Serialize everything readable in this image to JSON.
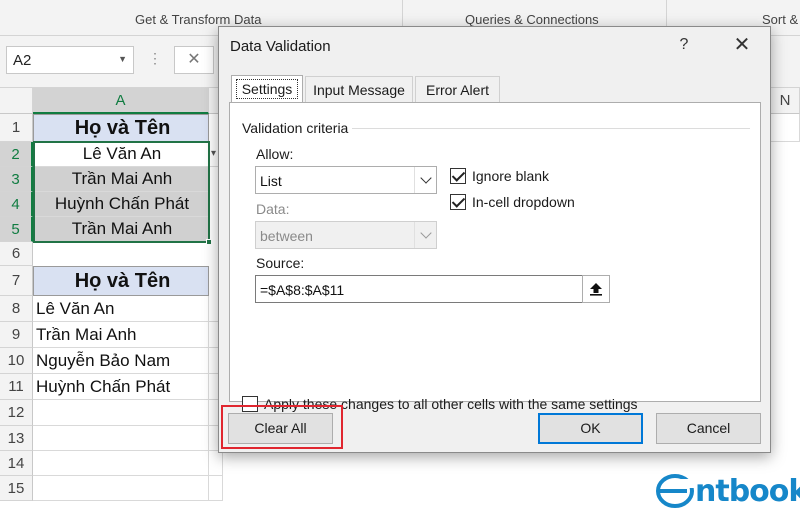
{
  "ribbon": {
    "groups": [
      "Get & Transform Data",
      "Queries & Connections",
      "Sort &"
    ]
  },
  "formula_bar": {
    "name_box": "A2",
    "cancel_symbol": "✕"
  },
  "sheet": {
    "columns": [
      "A",
      "N"
    ],
    "rows": [
      "1",
      "2",
      "3",
      "4",
      "5",
      "6",
      "7",
      "8",
      "9",
      "10",
      "11",
      "12",
      "13",
      "14",
      "15"
    ],
    "header1": "Họ và Tên",
    "list1": [
      "Lê Văn An",
      "Trần Mai Anh",
      "Huỳnh Chấn Phát",
      "Trần Mai Anh"
    ],
    "header2": "Họ và Tên",
    "list2": [
      "Lê Văn An",
      "Trần Mai Anh",
      "Nguyễn Bảo Nam",
      "Huỳnh Chấn Phát"
    ],
    "selection_color": "#217346",
    "header_fill": "#d9e1f2"
  },
  "dialog": {
    "title": "Data Validation",
    "help": "?",
    "close": "✕",
    "tabs": [
      {
        "label": "Settings",
        "active": true
      },
      {
        "label": "Input Message",
        "active": false
      },
      {
        "label": "Error Alert",
        "active": false
      }
    ],
    "settings": {
      "group_label": "Validation criteria",
      "allow_label": "Allow:",
      "allow_value": "List",
      "data_label": "Data:",
      "data_value": "between",
      "ignore_blank_label": "Ignore blank",
      "ignore_blank_checked": true,
      "incell_dropdown_label": "In-cell dropdown",
      "incell_dropdown_checked": true,
      "source_label": "Source:",
      "source_value": "=$A$8:$A$11",
      "apply_all_label": "Apply these changes to all other cells with the same settings",
      "apply_all_checked": false
    },
    "buttons": {
      "clear_all": "Clear All",
      "ok": "OK",
      "cancel": "Cancel"
    },
    "highlight_color": "#e0262f",
    "default_button_color": "#0078d7"
  },
  "watermark": {
    "logo_text": "ntbook",
    "brand_color": "#1687c9"
  }
}
